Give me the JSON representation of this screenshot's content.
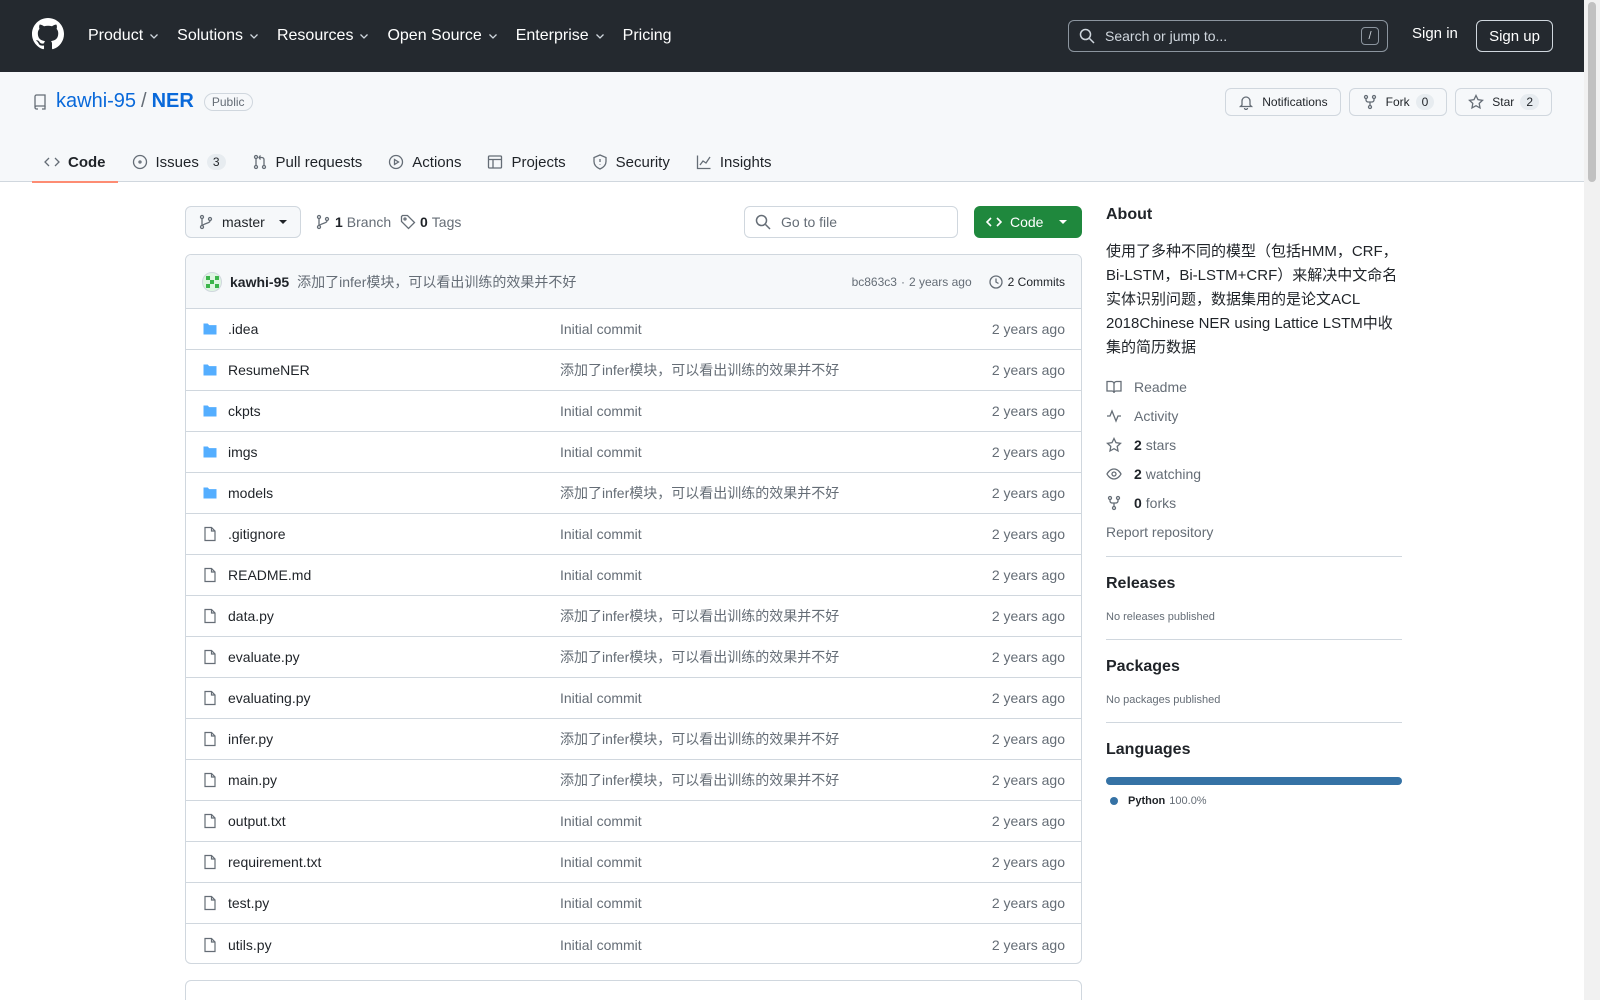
{
  "header": {
    "nav": [
      {
        "label": "Product",
        "dropdown": true
      },
      {
        "label": "Solutions",
        "dropdown": true
      },
      {
        "label": "Resources",
        "dropdown": true
      },
      {
        "label": "Open Source",
        "dropdown": true
      },
      {
        "label": "Enterprise",
        "dropdown": true
      },
      {
        "label": "Pricing",
        "dropdown": false
      }
    ],
    "search_placeholder": "Search or jump to...",
    "search_shortcut": "/",
    "sign_in": "Sign in",
    "sign_up": "Sign up"
  },
  "repo": {
    "owner": "kawhi-95",
    "separator": "/",
    "name": "NER",
    "visibility": "Public",
    "notifications_label": "Notifications",
    "fork_label": "Fork",
    "fork_count": "0",
    "star_label": "Star",
    "star_count": "2"
  },
  "tabs": [
    {
      "label": "Code",
      "icon": "code-icon",
      "active": true,
      "count": ""
    },
    {
      "label": "Issues",
      "icon": "issue-icon",
      "active": false,
      "count": "3"
    },
    {
      "label": "Pull requests",
      "icon": "pull-request-icon",
      "active": false,
      "count": ""
    },
    {
      "label": "Actions",
      "icon": "play-icon",
      "active": false,
      "count": ""
    },
    {
      "label": "Projects",
      "icon": "table-icon",
      "active": false,
      "count": ""
    },
    {
      "label": "Security",
      "icon": "shield-icon",
      "active": false,
      "count": ""
    },
    {
      "label": "Insights",
      "icon": "graph-icon",
      "active": false,
      "count": ""
    }
  ],
  "toolbar": {
    "branch": "master",
    "branch_count": "1",
    "branch_label": "Branch",
    "tag_count": "0",
    "tag_label": "Tags",
    "goto_placeholder": "Go to file",
    "code_button": "Code"
  },
  "commit": {
    "author": "kawhi-95",
    "message": "添加了infer模块，可以看出训练的效果并不好",
    "hash": "bc863c3",
    "dot": "·",
    "time": "2 years ago",
    "commits_label": "2 Commits"
  },
  "files": [
    {
      "name": ".idea",
      "type": "dir",
      "message": "Initial commit",
      "time": "2 years ago"
    },
    {
      "name": "ResumeNER",
      "type": "dir",
      "message": "添加了infer模块，可以看出训练的效果并不好",
      "time": "2 years ago"
    },
    {
      "name": "ckpts",
      "type": "dir",
      "message": "Initial commit",
      "time": "2 years ago"
    },
    {
      "name": "imgs",
      "type": "dir",
      "message": "Initial commit",
      "time": "2 years ago"
    },
    {
      "name": "models",
      "type": "dir",
      "message": "添加了infer模块，可以看出训练的效果并不好",
      "time": "2 years ago"
    },
    {
      "name": ".gitignore",
      "type": "file",
      "message": "Initial commit",
      "time": "2 years ago"
    },
    {
      "name": "README.md",
      "type": "file",
      "message": "Initial commit",
      "time": "2 years ago"
    },
    {
      "name": "data.py",
      "type": "file",
      "message": "添加了infer模块，可以看出训练的效果并不好",
      "time": "2 years ago"
    },
    {
      "name": "evaluate.py",
      "type": "file",
      "message": "添加了infer模块，可以看出训练的效果并不好",
      "time": "2 years ago"
    },
    {
      "name": "evaluating.py",
      "type": "file",
      "message": "Initial commit",
      "time": "2 years ago"
    },
    {
      "name": "infer.py",
      "type": "file",
      "message": "添加了infer模块，可以看出训练的效果并不好",
      "time": "2 years ago"
    },
    {
      "name": "main.py",
      "type": "file",
      "message": "添加了infer模块，可以看出训练的效果并不好",
      "time": "2 years ago"
    },
    {
      "name": "output.txt",
      "type": "file",
      "message": "Initial commit",
      "time": "2 years ago"
    },
    {
      "name": "requirement.txt",
      "type": "file",
      "message": "Initial commit",
      "time": "2 years ago"
    },
    {
      "name": "test.py",
      "type": "file",
      "message": "Initial commit",
      "time": "2 years ago"
    },
    {
      "name": "utils.py",
      "type": "file",
      "message": "Initial commit",
      "time": "2 years ago"
    }
  ],
  "sidebar": {
    "about_title": "About",
    "about_description": "使用了多种不同的模型（包括HMM，CRF，Bi-LSTM，Bi-LSTM+CRF）来解决中文命名实体识别问题，数据集用的是论文ACL 2018Chinese NER using Lattice LSTM中收集的简历数据",
    "readme": "Readme",
    "activity": "Activity",
    "stars_count": "2",
    "stars_label": "stars",
    "watching_count": "2",
    "watching_label": "watching",
    "forks_count": "0",
    "forks_label": "forks",
    "report": "Report repository",
    "releases_title": "Releases",
    "releases_text": "No releases published",
    "packages_title": "Packages",
    "packages_text": "No packages published",
    "languages_title": "Languages",
    "language_name": "Python",
    "language_percent": "100.0%",
    "language_fraction": 1.0,
    "language_color": "#3572a5"
  },
  "colors": {
    "header_bg": "#24292f",
    "link": "#0969da",
    "primary_button": "#1f883d",
    "active_tab_underline": "#fd8c73"
  }
}
